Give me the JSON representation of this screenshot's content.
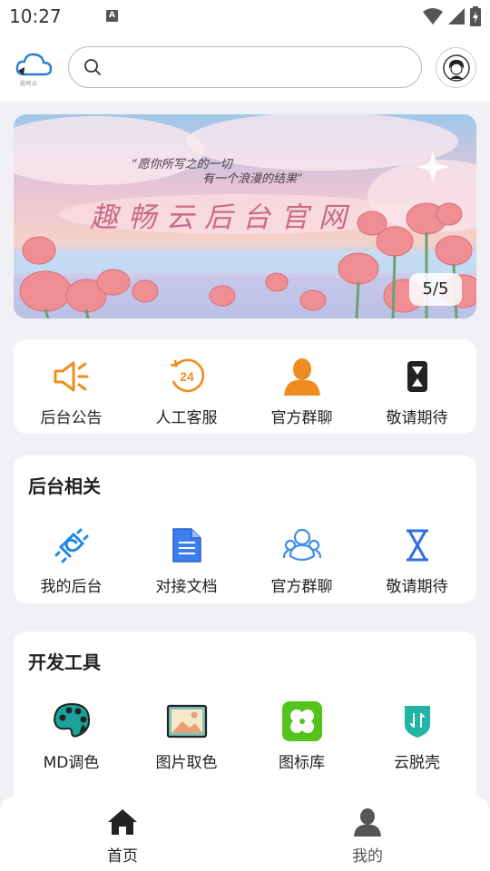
{
  "status_bar": {
    "time": "10:27",
    "notification_icon": "a-notification-icon",
    "wifi_icon": "wifi-icon",
    "signal_icon": "cellular-signal-icon",
    "battery_icon": "battery-charging-icon"
  },
  "header": {
    "logo_icon": "cloud-logo-icon",
    "logo_text": "趣畅云",
    "search": {
      "placeholder": "",
      "value": ""
    },
    "avatar_icon": "user-avatar-icon"
  },
  "banner": {
    "line1": "“愿你所写之的一切",
    "line2": "有一个浪漫的结果”",
    "title": "趣畅云后台官网",
    "counter": "5/5"
  },
  "quick_actions": [
    {
      "label": "后台公告",
      "icon": "megaphone-icon",
      "color": "#f08c1e"
    },
    {
      "label": "人工客服",
      "icon": "clock-24h-icon",
      "color": "#f08c1e"
    },
    {
      "label": "官方群聊",
      "icon": "person-icon",
      "color": "#f08c1e"
    },
    {
      "label": "敬请期待",
      "icon": "hourglass-icon",
      "color": "#222222"
    }
  ],
  "backend_section": {
    "title": "后台相关",
    "items": [
      {
        "label": "我的后台",
        "icon": "plug-icon",
        "color": "#1e88e5"
      },
      {
        "label": "对接文档",
        "icon": "document-icon",
        "color": "#2f6fe0"
      },
      {
        "label": "官方群聊",
        "icon": "group-icon",
        "color": "#3f8ee8"
      },
      {
        "label": "敬请期待",
        "icon": "hourglass-icon",
        "color": "#2f6fe0"
      }
    ]
  },
  "dev_tools_section": {
    "title": "开发工具",
    "items": [
      {
        "label": "MD调色",
        "icon": "palette-icon",
        "color": "#1aa39a"
      },
      {
        "label": "图片取色",
        "icon": "image-icon",
        "color": "#e8a07a"
      },
      {
        "label": "图标库",
        "icon": "clover-icon",
        "color": "#52c41a"
      },
      {
        "label": "云脱壳",
        "icon": "shield-icon",
        "color": "#23b4a4"
      }
    ]
  },
  "bottom_nav": {
    "home_label": "首页",
    "home_icon": "home-icon",
    "mine_label": "我的",
    "mine_icon": "user-icon",
    "active_color": "#222222",
    "inactive_color": "#555555"
  }
}
